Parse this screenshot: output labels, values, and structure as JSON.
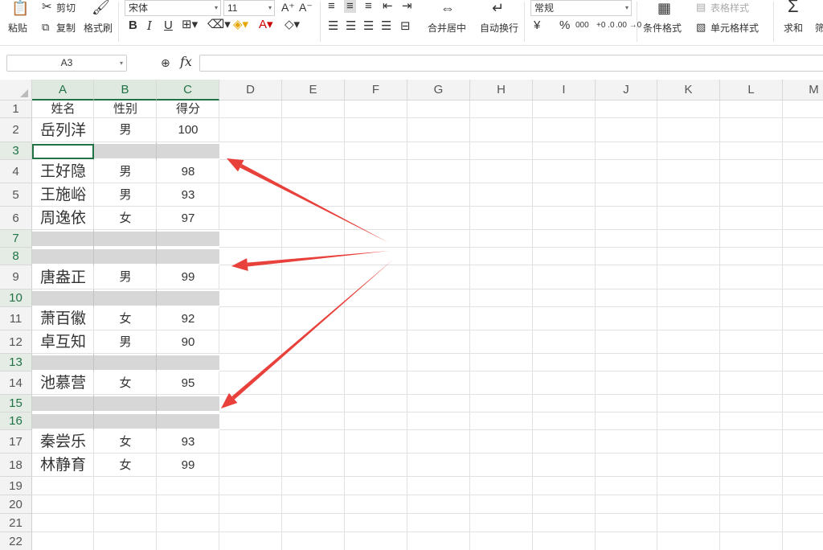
{
  "ribbon": {
    "clipboard": {
      "paste": "粘贴",
      "cut": "剪切",
      "copy": "复制",
      "format_painter": "格式刷"
    },
    "font": {
      "name": "宋体",
      "size": "11",
      "bold": "B",
      "italic": "I",
      "underline": "U"
    },
    "alignment": {
      "merge_center": "合并居中",
      "wrap_text": "自动换行"
    },
    "number": {
      "format": "常规",
      "currency": "¥",
      "percent": "%",
      "thousands": "000",
      "inc_dec": "+0 .0",
      "dec_dec": ".00 →0"
    },
    "styles": {
      "conditional": "条件格式",
      "table_style": "表格样式",
      "cell_style": "单元格样式"
    },
    "editing": {
      "sum": "求和",
      "sum_symbol": "Σ",
      "filter_partial": "筛"
    }
  },
  "formula_bar": {
    "name_box": "A3",
    "fx": "fx",
    "formula": ""
  },
  "columns": [
    "A",
    "B",
    "C",
    "D",
    "E",
    "F",
    "G",
    "H",
    "I",
    "J",
    "K",
    "L",
    "M"
  ],
  "row_numbers": [
    "1",
    "2",
    "3",
    "4",
    "5",
    "6",
    "7",
    "8",
    "9",
    "10",
    "11",
    "12",
    "13",
    "14",
    "15",
    "16",
    "17",
    "18",
    "19",
    "20",
    "21",
    "22"
  ],
  "rows": [
    {
      "a": "姓名",
      "b": "性别",
      "c": "得分"
    },
    {
      "a": "岳列洋",
      "b": "男",
      "c": "100"
    },
    {
      "a": "",
      "b": "",
      "c": ""
    },
    {
      "a": "王好隐",
      "b": "男",
      "c": "98"
    },
    {
      "a": "王施峪",
      "b": "男",
      "c": "93"
    },
    {
      "a": "周逸依",
      "b": "女",
      "c": "97"
    },
    {
      "a": "",
      "b": "",
      "c": ""
    },
    {
      "a": "",
      "b": "",
      "c": ""
    },
    {
      "a": "唐盎正",
      "b": "男",
      "c": "99"
    },
    {
      "a": "",
      "b": "",
      "c": ""
    },
    {
      "a": "萧百徽",
      "b": "女",
      "c": "92"
    },
    {
      "a": "卓互知",
      "b": "男",
      "c": "90"
    },
    {
      "a": "",
      "b": "",
      "c": ""
    },
    {
      "a": "池慕营",
      "b": "女",
      "c": "95"
    },
    {
      "a": "",
      "b": "",
      "c": ""
    },
    {
      "a": "",
      "b": "",
      "c": ""
    },
    {
      "a": "秦尝乐",
      "b": "女",
      "c": "93"
    },
    {
      "a": "林静育",
      "b": "女",
      "c": "99"
    }
  ],
  "colors": {
    "accent_green": "#217346",
    "blank_row_fill": "#d7d7d7",
    "arrow": "#e8403a"
  }
}
